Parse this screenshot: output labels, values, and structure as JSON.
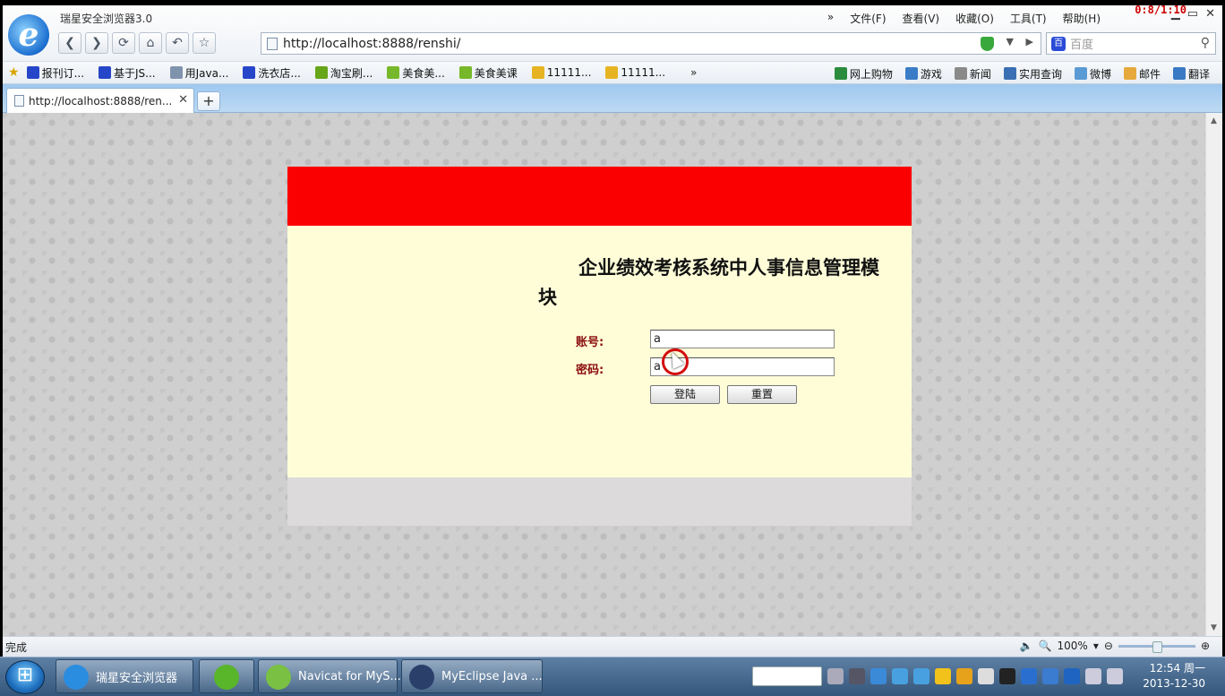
{
  "browser": {
    "app_title": "瑞星安全浏览器3.0",
    "menu": {
      "more": "»",
      "file": "文件(F)",
      "view": "查看(V)",
      "favorites": "收藏(O)",
      "tools": "工具(T)",
      "help": "帮助(H)"
    },
    "recording_counter": "0:8/1:10",
    "window_close": "✕",
    "address": "http://localhost:8888/renshi/",
    "search_placeholder": "百度",
    "favorites": [
      {
        "label": "报刊订...",
        "color": "#2646c9"
      },
      {
        "label": "基于JS...",
        "color": "#2646c9"
      },
      {
        "label": "用Java...",
        "color": "#7f93ad"
      },
      {
        "label": "洗衣店...",
        "color": "#2646c9"
      },
      {
        "label": "淘宝刷...",
        "color": "#67a519"
      },
      {
        "label": "美食美...",
        "color": "#76b82a"
      },
      {
        "label": "美食美课",
        "color": "#76b82a"
      },
      {
        "label": "11111...",
        "color": "#e6b422"
      },
      {
        "label": "11111...",
        "color": "#e6b422"
      }
    ],
    "favorites_more": "»",
    "favorites_right": [
      {
        "label": "网上购物",
        "color": "#2b8c3e"
      },
      {
        "label": "游戏",
        "color": "#3b7cc7"
      },
      {
        "label": "新闻",
        "color": "#8a8a8a"
      },
      {
        "label": "实用查询",
        "color": "#3a6fb4"
      },
      {
        "label": "微博",
        "color": "#5b9bd5"
      },
      {
        "label": "邮件",
        "color": "#e6a93b"
      },
      {
        "label": "翻译",
        "color": "#3a79c4"
      }
    ],
    "tab_title": "http://localhost:8888/ren...",
    "tab_close": "✕",
    "new_tab": "+",
    "status": "完成",
    "zoom": "100%"
  },
  "page": {
    "title": "企业绩效考核系统中人事信息管理模块",
    "account_label": "账号:",
    "account_value": "a",
    "password_label": "密码:",
    "password_value": "a",
    "login_button": "登陆",
    "reset_button": "重置",
    "colors": {
      "header": "#fb0000",
      "body": "#fffdd8",
      "footer": "#dcdadb",
      "label": "#8b0d0d"
    }
  },
  "taskbar": {
    "items": [
      {
        "label": "瑞星安全浏览器",
        "color": "#2a8de0"
      },
      {
        "label": "",
        "color": "#59b52a"
      },
      {
        "label": "Navicat for MyS...",
        "color": "#7ac043"
      },
      {
        "label": "MyEclipse Java ...",
        "color": "#2b3f6b"
      }
    ],
    "time": "12:54 周一",
    "date": "2013-12-30"
  }
}
